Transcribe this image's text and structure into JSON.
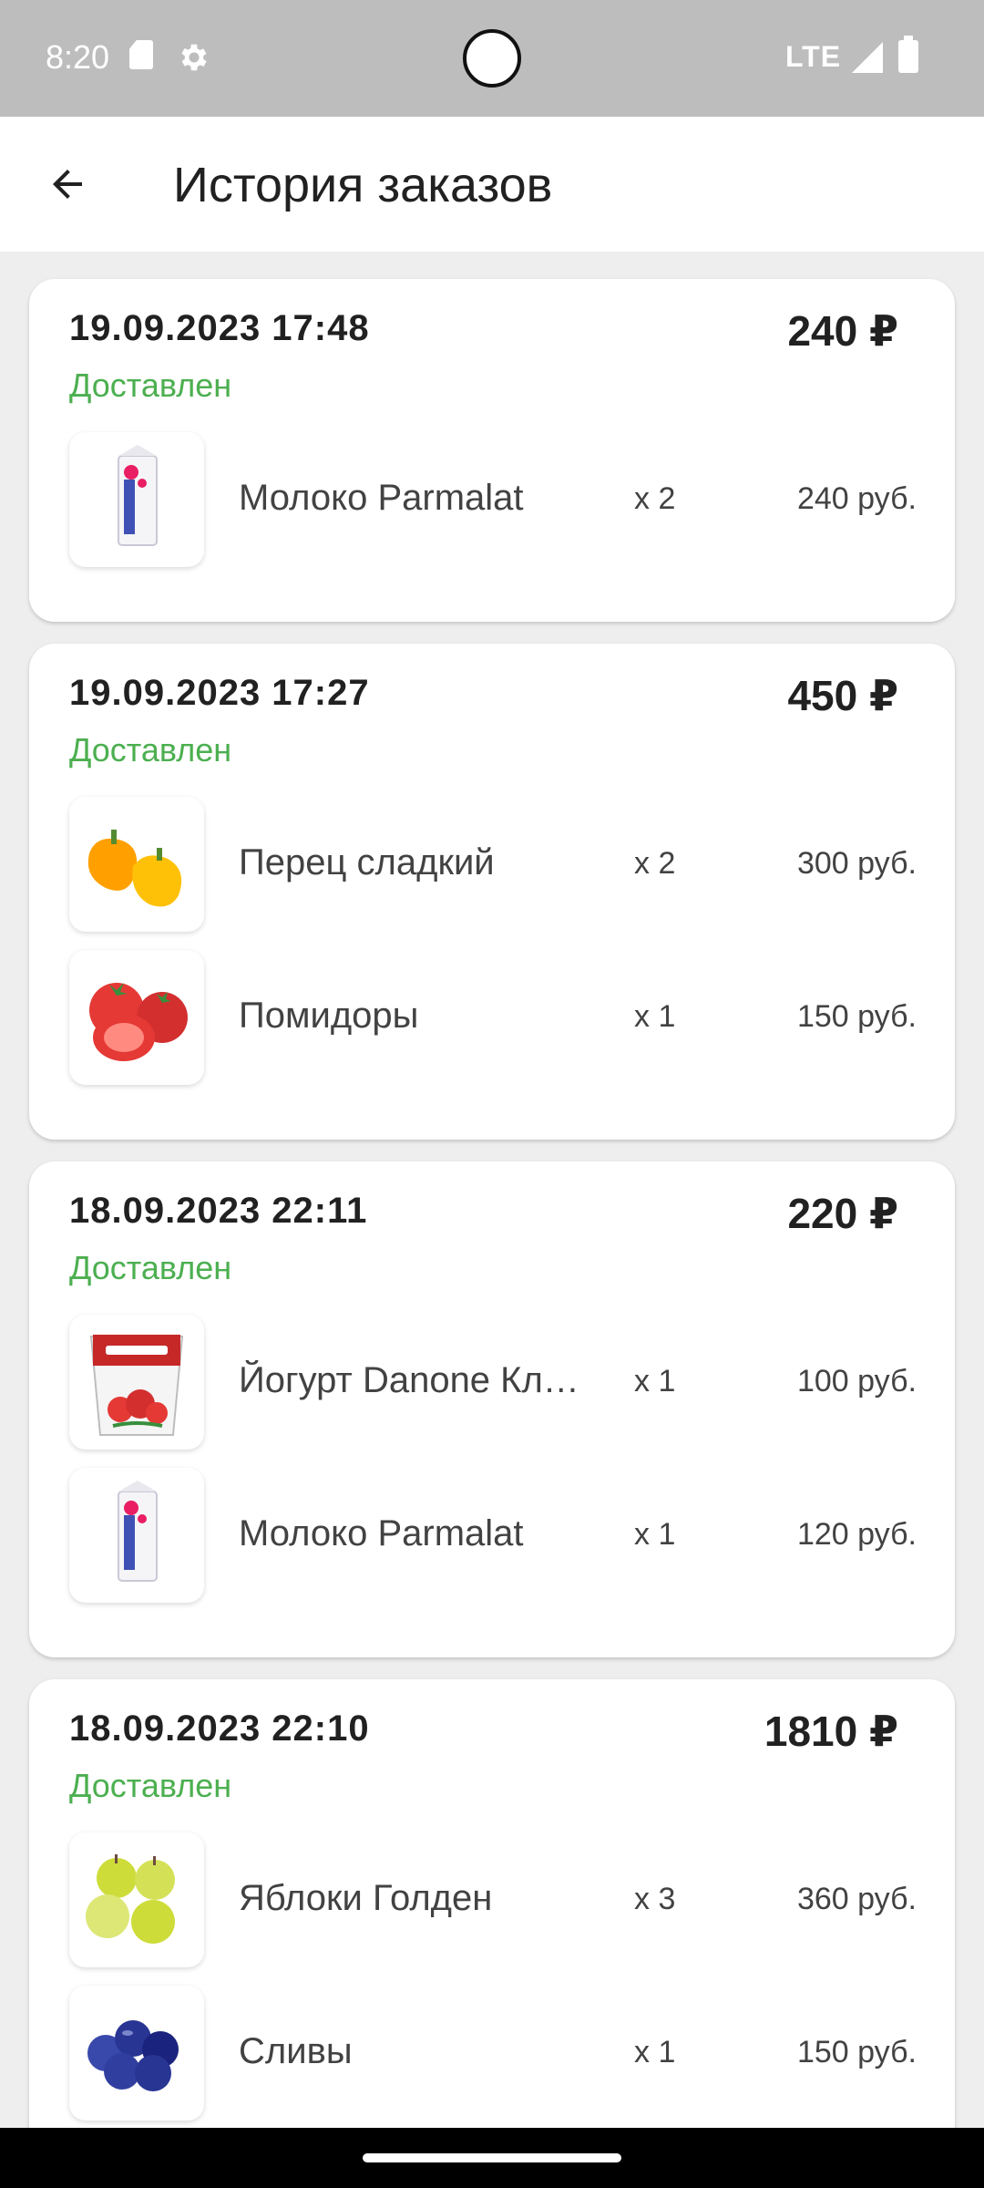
{
  "status_bar": {
    "time": "8:20",
    "network": "LTE",
    "icons": [
      "sd-card-icon",
      "settings-gear-icon",
      "signal-icon",
      "battery-icon"
    ]
  },
  "app_bar": {
    "title": "История заказов",
    "back_icon": "arrow-left-icon"
  },
  "colors": {
    "status_delivered": "#4caf50",
    "background": "#eeeeee",
    "status_bar": "#bdbdbd"
  },
  "orders": [
    {
      "date": "19.09.2023 17:48",
      "total": "240 ₽",
      "status": "Доставлен",
      "items": [
        {
          "name": "Молоко Parmalat",
          "qty": "x 2",
          "price": "240 руб.",
          "icon": "milk-carton-icon"
        }
      ]
    },
    {
      "date": "19.09.2023 17:27",
      "total": "450 ₽",
      "status": "Доставлен",
      "items": [
        {
          "name": "Перец сладкий",
          "qty": "x 2",
          "price": "300 руб.",
          "icon": "pepper-icon"
        },
        {
          "name": "Помидоры",
          "qty": "x 1",
          "price": "150 руб.",
          "icon": "tomato-icon"
        }
      ]
    },
    {
      "date": "18.09.2023 22:11",
      "total": "220 ₽",
      "status": "Доставлен",
      "items": [
        {
          "name": "Йогурт Danone Кл…",
          "qty": "x 1",
          "price": "100 руб.",
          "icon": "yogurt-cup-icon"
        },
        {
          "name": "Молоко Parmalat",
          "qty": "x 1",
          "price": "120 руб.",
          "icon": "milk-carton-icon"
        }
      ]
    },
    {
      "date": "18.09.2023 22:10",
      "total": "1810 ₽",
      "status": "Доставлен",
      "items": [
        {
          "name": "Яблоки Голден",
          "qty": "x 3",
          "price": "360 руб.",
          "icon": "apple-icon"
        },
        {
          "name": "Сливы",
          "qty": "x 1",
          "price": "150 руб.",
          "icon": "plum-icon"
        }
      ]
    }
  ]
}
